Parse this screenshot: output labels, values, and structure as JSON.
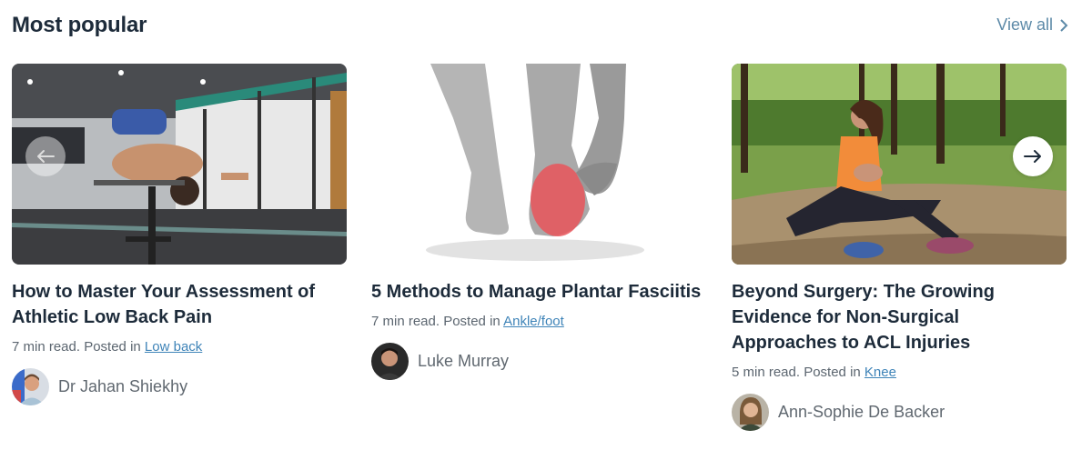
{
  "section": {
    "title": "Most popular",
    "view_all": "View all"
  },
  "cards": [
    {
      "title": "How to Master Your Assessment of Athletic Low Back Pain",
      "meta_prefix": "7 min read. Posted in ",
      "category": "Low back",
      "author": "Dr Jahan Shiekhy"
    },
    {
      "title": "5 Methods to Manage Plantar Fasciitis",
      "meta_prefix": "7 min read. Posted in ",
      "category": "Ankle/foot",
      "author": "Luke Murray"
    },
    {
      "title": "Beyond Surgery: The Growing Evidence for Non-Surgical Approaches to ACL Injuries",
      "meta_prefix": "5 min read. Posted in ",
      "category": "Knee",
      "author": "Ann-Sophie De Backer"
    }
  ],
  "icons": {
    "prev": "arrow-left-icon",
    "next": "arrow-right-icon",
    "view_all": "chevron-right-icon"
  }
}
